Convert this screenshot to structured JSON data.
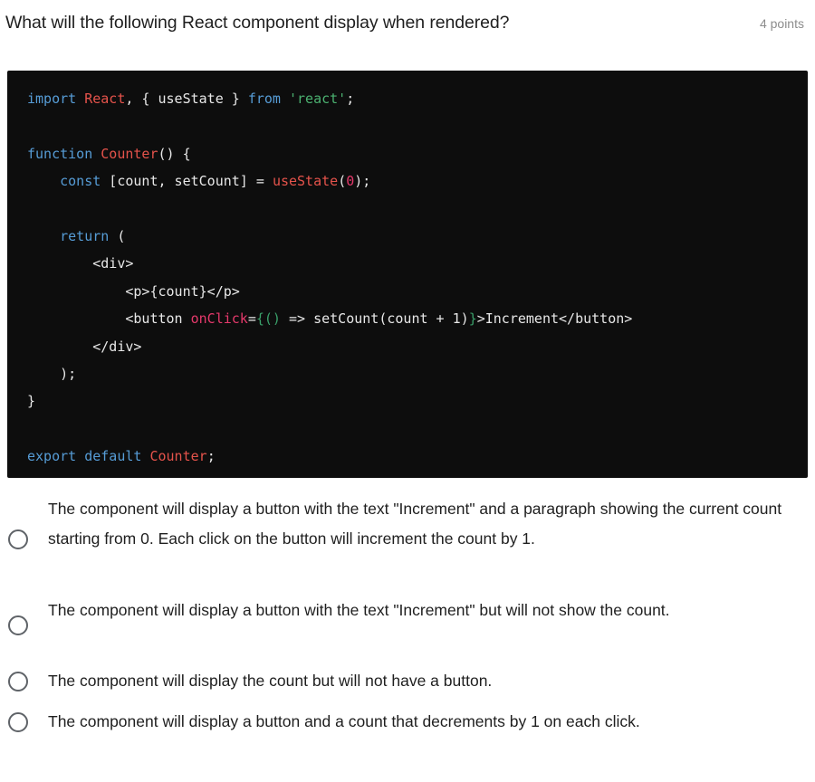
{
  "question": {
    "prompt": "What will the following React component display when rendered?",
    "points_label": "4 points"
  },
  "code_block": {
    "language": "jsx",
    "scroll_button_icon": "arrow-down-icon",
    "lines": [
      "import React, { useState } from 'react';",
      "",
      "function Counter() {",
      "    const [count, setCount] = useState(0);",
      "",
      "    return (",
      "        <div>",
      "            <p>{count}</p>",
      "            <button onClick={() => setCount(count + 1)}>Increment</button>",
      "        </div>",
      "    );",
      "}",
      "",
      "export default Counter;"
    ],
    "tokens": {
      "t_import": "import",
      "t_react": "React",
      "t_comma_brace_usestate": ", { useState } ",
      "t_from": "from",
      "t_react_string": "'react'",
      "t_semicolon": ";",
      "t_function": "function",
      "t_counter": "Counter",
      "t_parens_brace": "() {",
      "t_const": "const",
      "t_destructure": " [count, setCount] = ",
      "t_usestate": "useState",
      "t_open_paren": "(",
      "t_zero": "0",
      "t_close_paren_semi": ");",
      "t_return": "return",
      "t_return_paren": " (",
      "t_div_open": "<div>",
      "t_p_line": "<p>{count}</p>",
      "t_button_open": "<button ",
      "t_onclick": "onClick",
      "t_eq": "=",
      "t_jsx_open_brace": "{()",
      "t_arrow_setcount": " => setCount(count + 1)",
      "t_jsx_close_brace": "}",
      "t_button_rest": ">Increment</button>",
      "t_div_close": "</div>",
      "t_close_paren": "    );",
      "t_func_close": "}",
      "t_export": "export default",
      "t_counter_export": "Counter",
      "t_export_semi": ";"
    }
  },
  "answers": {
    "options": [
      {
        "id": "option-a",
        "text": "The component will display a button with the text \"Increment\" and a paragraph showing the current count starting from 0. Each click on the button will increment the count by 1.",
        "selected": false
      },
      {
        "id": "option-b",
        "text": "The component will display a button with the text \"Increment\" but will not show the count.",
        "selected": false
      },
      {
        "id": "option-c",
        "text": "The component will display the count but will not have a button.",
        "selected": false
      },
      {
        "id": "option-d",
        "text": "The component will display a button and a count that decrements by 1 on each click.",
        "selected": false
      }
    ]
  },
  "colors": {
    "code_background": "#0d0d0d",
    "keyword": "#569cd6",
    "type_identifier": "#e5534b",
    "string": "#4bb170",
    "attribute": "#e5396b",
    "jsx_brace": "#3aa06a",
    "plain_text": "#e8e8e8",
    "page_background": "#ffffff",
    "text_primary": "#1f1f1f",
    "text_muted": "#8c8c8c",
    "radio_border": "#5f6368"
  }
}
